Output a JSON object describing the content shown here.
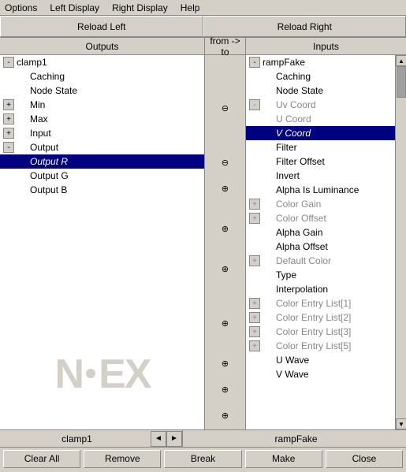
{
  "menubar": {
    "items": [
      "Options",
      "Left Display",
      "Right Display",
      "Help"
    ]
  },
  "toolbar": {
    "reload_left": "Reload Left",
    "reload_right": "Reload Right"
  },
  "col_headers": {
    "left": "Outputs",
    "middle": "from -> to",
    "right": "Inputs"
  },
  "left_panel": {
    "root": "clamp1",
    "items": [
      {
        "label": "clamp1",
        "level": 0,
        "expander": "-",
        "indent": 0
      },
      {
        "label": "Caching",
        "level": 1,
        "expander": null,
        "indent": 1
      },
      {
        "label": "Node State",
        "level": 1,
        "expander": null,
        "indent": 1
      },
      {
        "label": "Min",
        "level": 1,
        "expander": "+",
        "indent": 0
      },
      {
        "label": "Max",
        "level": 1,
        "expander": "+",
        "indent": 0
      },
      {
        "label": "Input",
        "level": 1,
        "expander": "+",
        "indent": 0
      },
      {
        "label": "Output",
        "level": 1,
        "expander": "-",
        "indent": 0
      },
      {
        "label": "Output R",
        "level": 2,
        "expander": null,
        "indent": 1,
        "selected": true,
        "italic": true
      },
      {
        "label": "Output G",
        "level": 2,
        "expander": null,
        "indent": 1
      },
      {
        "label": "Output B",
        "level": 2,
        "expander": null,
        "indent": 1
      }
    ]
  },
  "right_panel": {
    "root": "rampFake",
    "items": [
      {
        "label": "rampFake",
        "level": 0,
        "expander": "-",
        "indent": 0
      },
      {
        "label": "Caching",
        "level": 1,
        "expander": null,
        "indent": 1
      },
      {
        "label": "Node State",
        "level": 1,
        "expander": null,
        "indent": 1
      },
      {
        "label": "Uv Coord",
        "level": 1,
        "expander": "-",
        "indent": 0,
        "grayed": true
      },
      {
        "label": "U Coord",
        "level": 2,
        "expander": null,
        "indent": 1,
        "grayed": true
      },
      {
        "label": "V Coord",
        "level": 2,
        "expander": null,
        "indent": 1,
        "selected": true,
        "italic": true
      },
      {
        "label": "Filter",
        "level": 1,
        "expander": null,
        "indent": 1
      },
      {
        "label": "Filter Offset",
        "level": 1,
        "expander": null,
        "indent": 1
      },
      {
        "label": "Invert",
        "level": 1,
        "expander": null,
        "indent": 1
      },
      {
        "label": "Alpha Is Luminance",
        "level": 1,
        "expander": null,
        "indent": 1
      },
      {
        "label": "Color Gain",
        "level": 1,
        "expander": "+",
        "indent": 0,
        "grayed": true
      },
      {
        "label": "Color Offset",
        "level": 1,
        "expander": "+",
        "indent": 0,
        "grayed": true
      },
      {
        "label": "Alpha Gain",
        "level": 1,
        "expander": null,
        "indent": 1
      },
      {
        "label": "Alpha Offset",
        "level": 1,
        "expander": null,
        "indent": 1
      },
      {
        "label": "Default Color",
        "level": 1,
        "expander": "+",
        "indent": 0,
        "grayed": true
      },
      {
        "label": "Type",
        "level": 1,
        "expander": null,
        "indent": 1
      },
      {
        "label": "Interpolation",
        "level": 1,
        "expander": null,
        "indent": 1
      },
      {
        "label": "Color Entry List[1]",
        "level": 1,
        "expander": "+",
        "indent": 0,
        "grayed": true
      },
      {
        "label": "Color Entry List[2]",
        "level": 1,
        "expander": "+",
        "indent": 0,
        "grayed": true
      },
      {
        "label": "Color Entry List[3]",
        "level": 1,
        "expander": "+",
        "indent": 0,
        "grayed": true
      },
      {
        "label": "Color Entry List[5]",
        "level": 1,
        "expander": "+",
        "indent": 0,
        "grayed": true
      },
      {
        "label": "U Wave",
        "level": 1,
        "expander": null,
        "indent": 1
      },
      {
        "label": "V Wave",
        "level": 1,
        "expander": null,
        "indent": 1
      }
    ]
  },
  "middle_markers": [
    "-",
    "-",
    "+",
    "+",
    "+",
    "+"
  ],
  "bottom_nav": {
    "left_label": "clamp1",
    "right_label": "rampFake",
    "arrow_prev": "◄",
    "arrow_next": "►"
  },
  "footer": {
    "clear_all": "Clear All",
    "remove": "Remove",
    "break": "Break",
    "make": "Make",
    "close": "Close"
  }
}
